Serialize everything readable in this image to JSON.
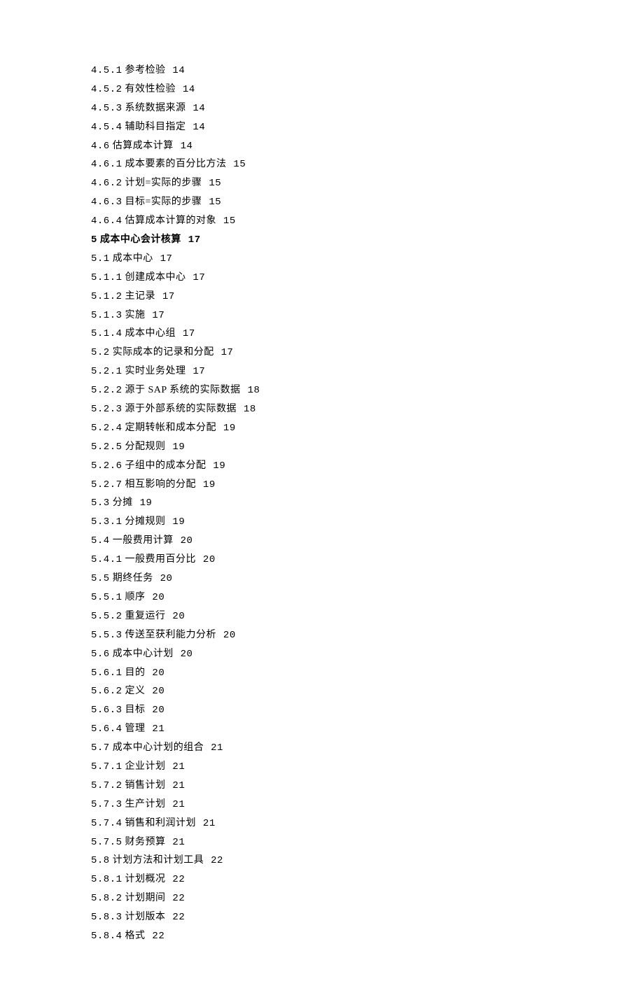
{
  "toc": [
    {
      "num": "4.5.1",
      "title": "参考检验",
      "page": "14",
      "bold": false
    },
    {
      "num": "4.5.2",
      "title": "有效性检验",
      "page": "14",
      "bold": false
    },
    {
      "num": "4.5.3",
      "title": "系统数据来源",
      "page": "14",
      "bold": false
    },
    {
      "num": "4.5.4",
      "title": "辅助科目指定",
      "page": "14",
      "bold": false
    },
    {
      "num": "4.6",
      "title": "估算成本计算",
      "page": "14",
      "bold": false
    },
    {
      "num": "4.6.1",
      "title": "成本要素的百分比方法",
      "page": "15",
      "bold": false
    },
    {
      "num": "4.6.2",
      "title": "计划=实际的步骤",
      "page": "15",
      "bold": false
    },
    {
      "num": "4.6.3",
      "title": "目标=实际的步骤",
      "page": "15",
      "bold": false
    },
    {
      "num": "4.6.4",
      "title": "估算成本计算的对象",
      "page": "15",
      "bold": false
    },
    {
      "num": "5",
      "title": "成本中心会计核算",
      "page": "17",
      "bold": true
    },
    {
      "num": "5.1",
      "title": "成本中心",
      "page": "17",
      "bold": false
    },
    {
      "num": "5.1.1",
      "title": "创建成本中心",
      "page": "17",
      "bold": false
    },
    {
      "num": "5.1.2",
      "title": "主记录",
      "page": "17",
      "bold": false
    },
    {
      "num": "5.1.3",
      "title": "实施",
      "page": "17",
      "bold": false
    },
    {
      "num": "5.1.4",
      "title": "成本中心组",
      "page": "17",
      "bold": false
    },
    {
      "num": "5.2",
      "title": "实际成本的记录和分配",
      "page": "17",
      "bold": false
    },
    {
      "num": "5.2.1",
      "title": "实时业务处理",
      "page": "17",
      "bold": false
    },
    {
      "num": "5.2.2",
      "title": "源于 SAP 系统的实际数据",
      "page": "18",
      "bold": false
    },
    {
      "num": "5.2.3",
      "title": "源于外部系统的实际数据",
      "page": "18",
      "bold": false
    },
    {
      "num": "5.2.4",
      "title": "定期转帐和成本分配",
      "page": "19",
      "bold": false
    },
    {
      "num": "5.2.5",
      "title": "分配规则",
      "page": "19",
      "bold": false
    },
    {
      "num": "5.2.6",
      "title": "子组中的成本分配",
      "page": "19",
      "bold": false
    },
    {
      "num": "5.2.7",
      "title": "相互影响的分配",
      "page": "19",
      "bold": false
    },
    {
      "num": "5.3",
      "title": "分摊",
      "page": "19",
      "bold": false
    },
    {
      "num": "5.3.1",
      "title": "分摊规则",
      "page": "19",
      "bold": false
    },
    {
      "num": "5.4",
      "title": "一般费用计算",
      "page": "20",
      "bold": false
    },
    {
      "num": "5.4.1",
      "title": "一般费用百分比",
      "page": "20",
      "bold": false
    },
    {
      "num": "5.5",
      "title": "期终任务",
      "page": "20",
      "bold": false
    },
    {
      "num": "5.5.1",
      "title": "顺序",
      "page": "20",
      "bold": false
    },
    {
      "num": "5.5.2",
      "title": "重复运行",
      "page": "20",
      "bold": false
    },
    {
      "num": "5.5.3",
      "title": "传送至获利能力分析",
      "page": "20",
      "bold": false
    },
    {
      "num": "5.6",
      "title": "成本中心计划",
      "page": "20",
      "bold": false
    },
    {
      "num": "5.6.1",
      "title": "目的",
      "page": "20",
      "bold": false
    },
    {
      "num": "5.6.2",
      "title": "定义",
      "page": "20",
      "bold": false
    },
    {
      "num": "5.6.3",
      "title": "目标",
      "page": "20",
      "bold": false
    },
    {
      "num": "5.6.4",
      "title": "管理",
      "page": "21",
      "bold": false
    },
    {
      "num": "5.7",
      "title": "成本中心计划的组合",
      "page": "21",
      "bold": false
    },
    {
      "num": "5.7.1",
      "title": "企业计划",
      "page": "21",
      "bold": false
    },
    {
      "num": "5.7.2",
      "title": "销售计划",
      "page": "21",
      "bold": false
    },
    {
      "num": "5.7.3",
      "title": "生产计划",
      "page": "21",
      "bold": false
    },
    {
      "num": "5.7.4",
      "title": "销售和利润计划",
      "page": "21",
      "bold": false
    },
    {
      "num": "5.7.5",
      "title": "财务预算",
      "page": "21",
      "bold": false
    },
    {
      "num": "5.8",
      "title": "计划方法和计划工具",
      "page": "22",
      "bold": false
    },
    {
      "num": "5.8.1",
      "title": "计划概况",
      "page": "22",
      "bold": false
    },
    {
      "num": "5.8.2",
      "title": "计划期间",
      "page": "22",
      "bold": false
    },
    {
      "num": "5.8.3",
      "title": "计划版本",
      "page": "22",
      "bold": false
    },
    {
      "num": "5.8.4",
      "title": "格式",
      "page": "22",
      "bold": false
    }
  ]
}
